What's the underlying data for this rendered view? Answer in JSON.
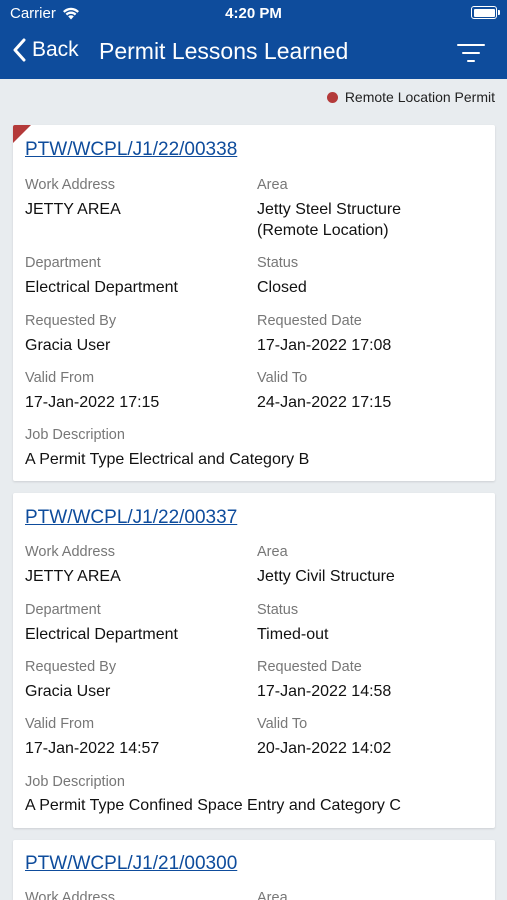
{
  "status_bar": {
    "carrier": "Carrier",
    "time": "4:20 PM"
  },
  "header": {
    "back_label": "Back",
    "title": "Permit Lessons Learned"
  },
  "legend": {
    "label": "Remote Location Permit",
    "color": "#b43a3a"
  },
  "labels": {
    "work_address": "Work Address",
    "area": "Area",
    "department": "Department",
    "status": "Status",
    "requested_by": "Requested By",
    "requested_date": "Requested Date",
    "valid_from": "Valid From",
    "valid_to": "Valid To",
    "job_description": "Job Description"
  },
  "permits": [
    {
      "number": "PTW/WCPL/J1/22/00338",
      "remote_location": true,
      "work_address": "JETTY AREA",
      "area_line1": "Jetty Steel Structure",
      "area_line2": "(Remote Location)",
      "department": "Electrical Department",
      "status": "Closed",
      "requested_by": "Gracia User",
      "requested_date": "17-Jan-2022 17:08",
      "valid_from": "17-Jan-2022 17:15",
      "valid_to": "24-Jan-2022 17:15",
      "job_description": "A Permit Type Electrical and Category B"
    },
    {
      "number": "PTW/WCPL/J1/22/00337",
      "remote_location": false,
      "work_address": "JETTY AREA",
      "area_line1": "Jetty Civil Structure",
      "department": "Electrical Department",
      "status": "Timed-out",
      "requested_by": "Gracia User",
      "requested_date": "17-Jan-2022 14:58",
      "valid_from": "17-Jan-2022 14:57",
      "valid_to": "20-Jan-2022 14:02",
      "job_description": "A Permit Type Confined Space Entry and Category C"
    },
    {
      "number": "PTW/WCPL/J1/21/00300",
      "remote_location": false
    }
  ]
}
